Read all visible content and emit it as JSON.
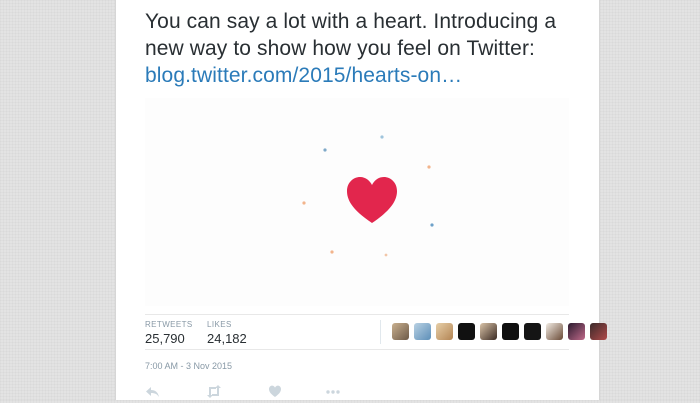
{
  "tweet": {
    "text": "You can say a lot with a heart. Introducing a new way to show how you feel on Twitter: ",
    "link": "blog.twitter.com/2015/hearts-on…"
  },
  "stats": {
    "retweets_label": "RETWEETS",
    "retweets_value": "25,790",
    "likes_label": "LIKES",
    "likes_value": "24,182"
  },
  "likers": [
    {
      "name": "liker-avatar-1"
    },
    {
      "name": "liker-avatar-2"
    },
    {
      "name": "liker-avatar-3"
    },
    {
      "name": "liker-avatar-4"
    },
    {
      "name": "liker-avatar-5"
    },
    {
      "name": "liker-avatar-6"
    },
    {
      "name": "liker-avatar-7"
    },
    {
      "name": "liker-avatar-8"
    },
    {
      "name": "liker-avatar-9"
    },
    {
      "name": "liker-avatar-10"
    }
  ],
  "timestamp": "7:00 AM - 3 Nov 2015",
  "actions": [
    {
      "icon": "reply-icon"
    },
    {
      "icon": "retweet-icon"
    },
    {
      "icon": "like-heart-icon"
    },
    {
      "icon": "more-icon"
    }
  ],
  "colors": {
    "link": "#2b7bb9",
    "heart": "#e2264d",
    "text": "#292f33",
    "muted": "#8899a6",
    "action_icon": "#ccd6dd"
  }
}
